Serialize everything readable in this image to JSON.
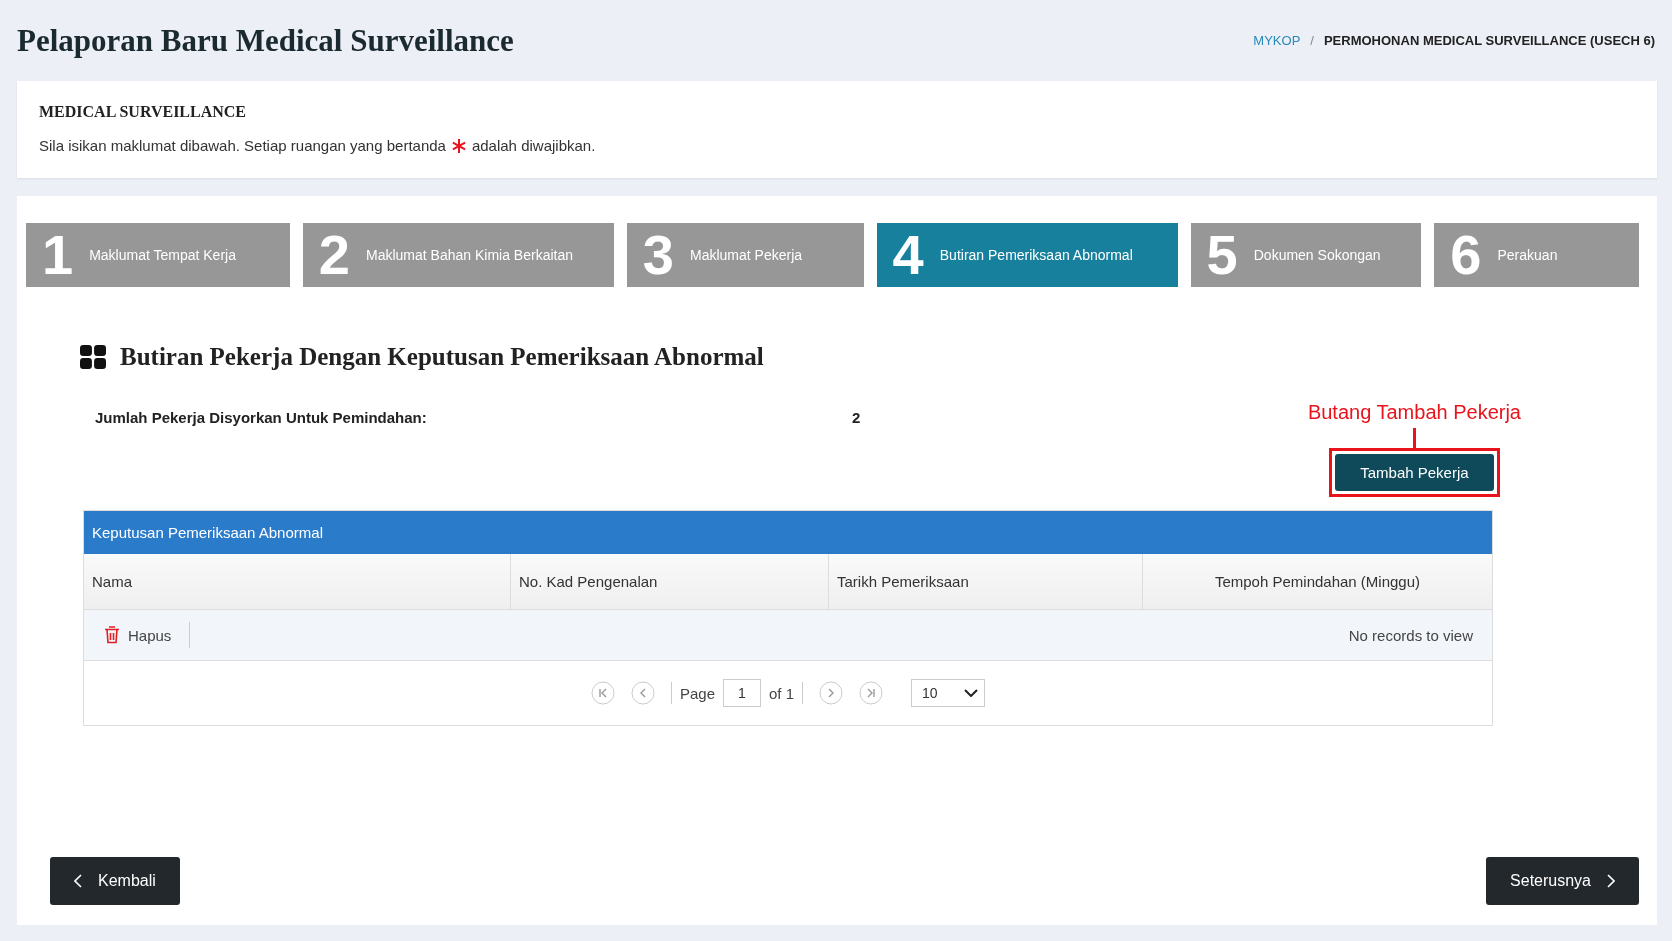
{
  "title": "Pelaporan Baru Medical Surveillance",
  "breadcrumb": [
    {
      "label": "MYKOP",
      "kind": "link"
    },
    {
      "label": "/",
      "kind": "separator"
    },
    {
      "label": "PERMOHONAN MEDICAL SURVEILLANCE (USECH 6)",
      "kind": "current"
    }
  ],
  "info_card": {
    "heading": "MEDICAL SURVEILLANCE",
    "instruction_before": "Sila isikan maklumat dibawah. Setiap ruangan yang bertanda",
    "instruction_after": "adalah diwajibkan."
  },
  "steps": [
    {
      "number": "1",
      "label": "Maklumat Tempat Kerja",
      "selected": false
    },
    {
      "number": "2",
      "label": "Maklumat Bahan Kimia Berkaitan",
      "selected": false
    },
    {
      "number": "3",
      "label": "Maklumat Pekerja",
      "selected": false
    },
    {
      "number": "4",
      "label": "Butiran Pemeriksaan Abnormal",
      "selected": true
    },
    {
      "number": "5",
      "label": "Dokumen Sokongan",
      "selected": false
    },
    {
      "number": "6",
      "label": "Perakuan",
      "selected": false
    }
  ],
  "section": {
    "heading": "Butiran Pekerja Dengan Keputusan Pemeriksaan Abnormal"
  },
  "summary": {
    "label": "Jumlah Pekerja Disyorkan Untuk Pemindahan:",
    "value": "2"
  },
  "annotation": {
    "label": "Butang Tambah Pekerja"
  },
  "add_button": "Tambah Pekerja",
  "table": {
    "caption": "Keputusan Pemeriksaan Abnormal",
    "columns": [
      "Nama",
      "No. Kad Pengenalan",
      "Tarikh Pemeriksaan",
      "Tempoh Pemindahan (Minggu)"
    ],
    "delete_label": "Hapus",
    "empty_text": "No records to view",
    "pager": {
      "page_label": "Page",
      "page_value": "1",
      "of_label": "of 1",
      "page_size": "10"
    }
  },
  "nav": {
    "back": "Kembali",
    "next": "Seterusnya"
  }
}
